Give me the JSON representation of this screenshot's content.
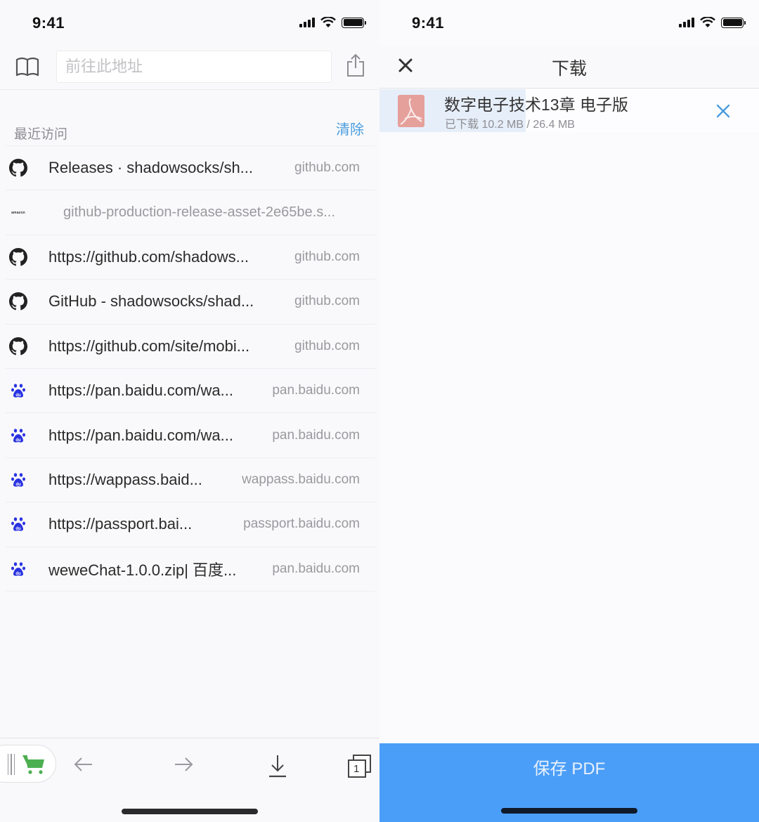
{
  "left": {
    "status_bar": {
      "time": "9:41"
    },
    "toolbar": {
      "address_placeholder": "前往此地址",
      "address_value": ""
    },
    "recent": {
      "title": "最近访问",
      "clear_label": "清除",
      "items": [
        {
          "icon": "github-icon",
          "title": "Releases · shadowsocks/sh...",
          "domain": "github.com"
        },
        {
          "icon": "amazon-icon",
          "title": "github-production-release-asset-2e65be.s...",
          "domain": ""
        },
        {
          "icon": "github-icon",
          "title": "https://github.com/shadows...",
          "domain": "github.com"
        },
        {
          "icon": "github-icon",
          "title": "GitHub - shadowsocks/shad...",
          "domain": "github.com"
        },
        {
          "icon": "github-icon",
          "title": "https://github.com/site/mobi...",
          "domain": "github.com"
        },
        {
          "icon": "baidu-icon",
          "title": "https://pan.baidu.com/wa...",
          "domain": "pan.baidu.com"
        },
        {
          "icon": "baidu-icon",
          "title": "https://pan.baidu.com/wa...",
          "domain": "pan.baidu.com"
        },
        {
          "icon": "baidu-icon",
          "title": "https://wappass.baid...",
          "domain": "wappass.baidu.com"
        },
        {
          "icon": "baidu-icon",
          "title": "https://passport.bai...",
          "domain": "passport.baidu.com"
        },
        {
          "icon": "baidu-icon",
          "title": "weweChat-1.0.0.zip| 百度...",
          "domain": "pan.baidu.com"
        }
      ],
      "amazon_label": "amazon"
    },
    "bottom_bar": {
      "tab_count": "1",
      "icons": [
        "cart-icon",
        "back-arrow-icon",
        "forward-arrow-icon",
        "download-icon",
        "tabs-icon"
      ]
    }
  },
  "right": {
    "status_bar": {
      "time": "9:41"
    },
    "header": {
      "title": "下载"
    },
    "download": {
      "name": "数字电子技术13章 电子版",
      "size_text": "已下载 10.2 MB / 26.4 MB",
      "downloaded_mb": 10.2,
      "total_mb": 26.4,
      "progress_fraction": 0.386
    },
    "save_button_label": "保存 PDF"
  },
  "colors": {
    "accent_blue": "#4a9de0",
    "save_button": "#4b9ef8",
    "pdf_icon": "#e6a09b",
    "progress_fill": "#e6eef9",
    "cart_green": "#4caf50",
    "baidu_blue": "#2932e1"
  }
}
